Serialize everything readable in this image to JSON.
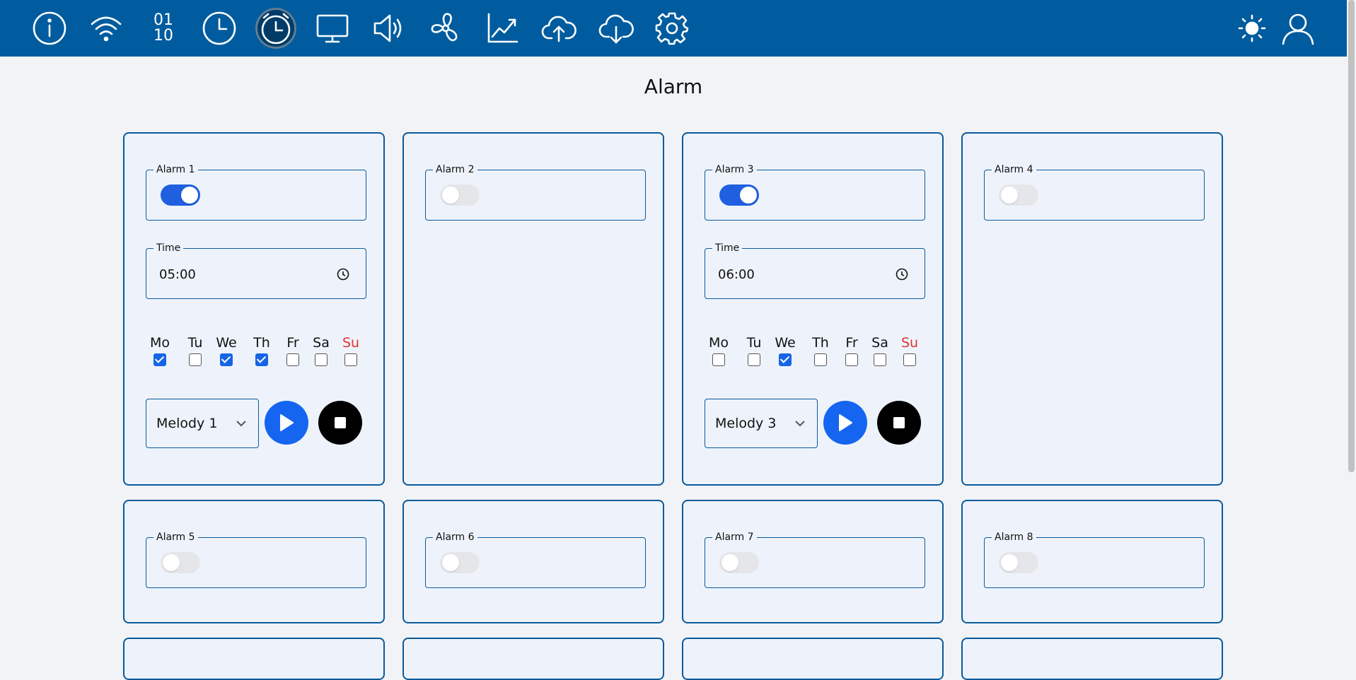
{
  "nav": {
    "icons": [
      "info-icon",
      "wifi-icon",
      "binary-icon",
      "clock-icon",
      "alarm-icon",
      "monitor-icon",
      "speaker-icon",
      "fan-icon",
      "chart-icon",
      "cloud-upload-icon",
      "cloud-download-icon",
      "gear-icon",
      "sun-icon",
      "user-icon"
    ],
    "active": "alarm-icon",
    "binary_top": "01",
    "binary_bottom": "10"
  },
  "page": {
    "title": "Alarm"
  },
  "days": [
    "Mo",
    "Tu",
    "We",
    "Th",
    "Fr",
    "Sa",
    "Su"
  ],
  "alarms": [
    {
      "label": "Alarm 1",
      "enabled": true,
      "time_label": "Time",
      "time": "05:00",
      "days": [
        true,
        false,
        true,
        true,
        false,
        false,
        false
      ],
      "melody": "Melody 1"
    },
    {
      "label": "Alarm 2",
      "enabled": false
    },
    {
      "label": "Alarm 3",
      "enabled": true,
      "time_label": "Time",
      "time": "06:00",
      "days": [
        false,
        false,
        true,
        false,
        false,
        false,
        false
      ],
      "melody": "Melody 3"
    },
    {
      "label": "Alarm 4",
      "enabled": false
    },
    {
      "label": "Alarm 5",
      "enabled": false
    },
    {
      "label": "Alarm 6",
      "enabled": false
    },
    {
      "label": "Alarm 7",
      "enabled": false
    },
    {
      "label": "Alarm 8",
      "enabled": false
    }
  ],
  "colors": {
    "topbar": "#005c9e",
    "accent": "#1565f0",
    "sunday": "#e0342b",
    "card_border": "#0a5a9a"
  }
}
